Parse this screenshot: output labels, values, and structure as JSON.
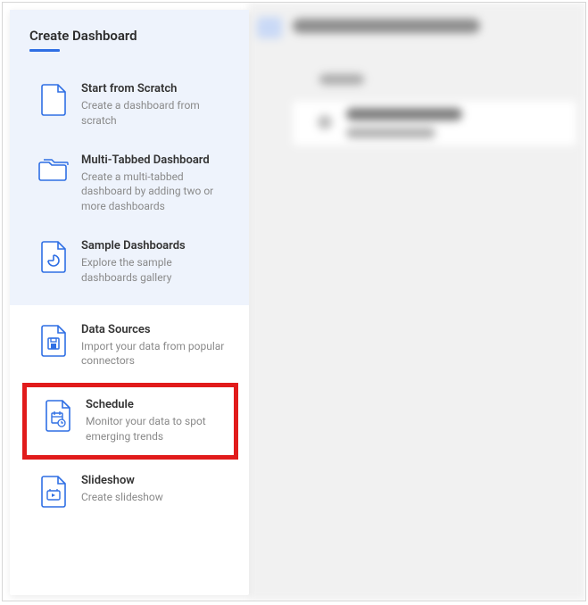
{
  "panel": {
    "title": "Create Dashboard",
    "groups": {
      "primary": [
        {
          "title": "Start from Scratch",
          "desc": "Create a dashboard from scratch",
          "icon": "blank-file-icon"
        },
        {
          "title": "Multi-Tabbed Dashboard",
          "desc": "Create a multi-tabbed dashboard by adding two or more dashboards",
          "icon": "multi-tab-icon"
        },
        {
          "title": "Sample Dashboards",
          "desc": "Explore the sample dashboards gallery",
          "icon": "sample-chart-icon"
        }
      ],
      "secondary": [
        {
          "title": "Data Sources",
          "desc": "Import your data from popular connectors",
          "icon": "data-save-icon"
        },
        {
          "title": "Schedule",
          "desc": "Monitor your data to spot emerging trends",
          "icon": "calendar-icon"
        },
        {
          "title": "Slideshow",
          "desc": "Create slideshow",
          "icon": "slideshow-icon"
        }
      ]
    }
  }
}
